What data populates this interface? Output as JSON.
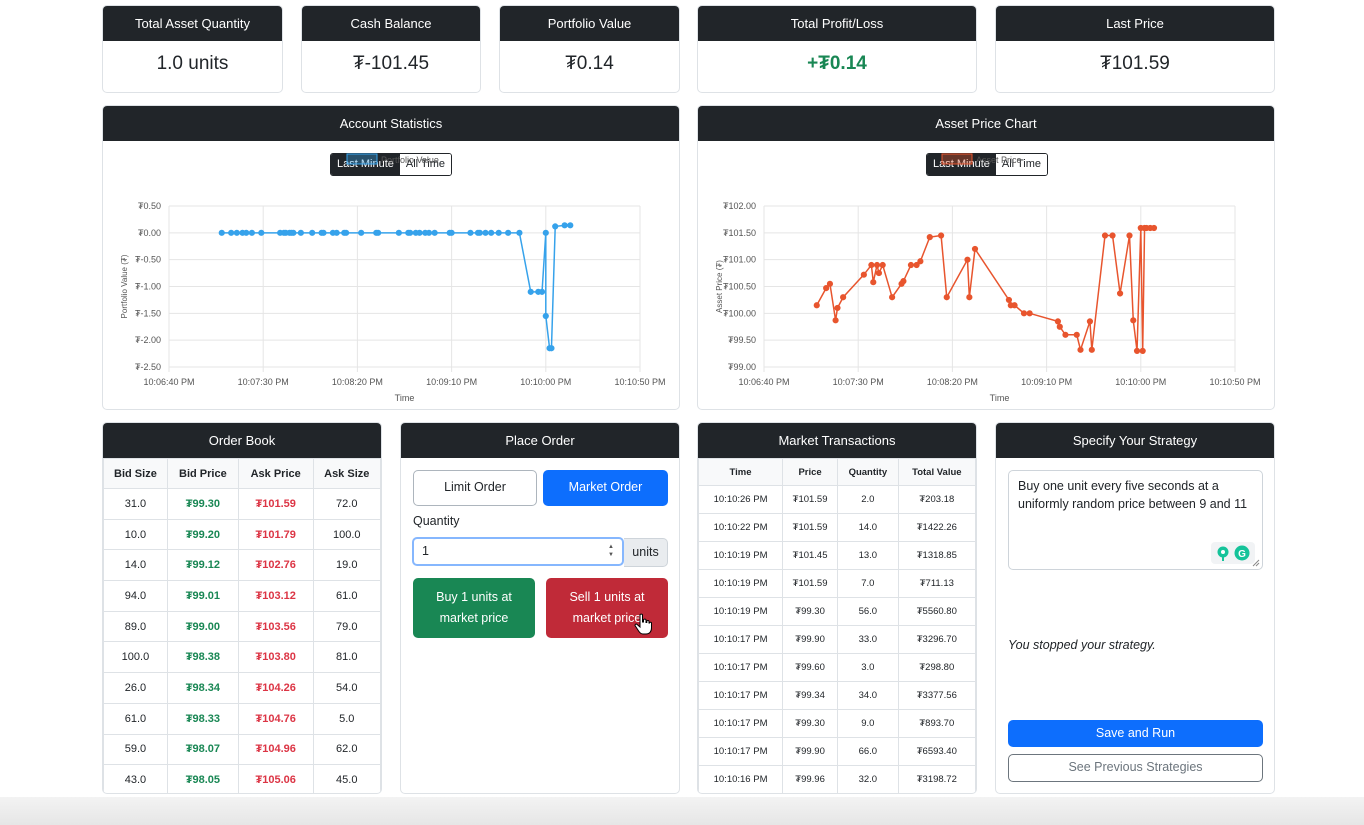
{
  "stats": [
    {
      "title": "Total Asset Quantity",
      "value": "1.0 units"
    },
    {
      "title": "Cash Balance",
      "value": "₮-101.45"
    },
    {
      "title": "Portfolio Value",
      "value": "₮0.14"
    },
    {
      "title": "Total Profit/Loss",
      "value": "+₮0.14"
    },
    {
      "title": "Last Price",
      "value": "₮101.59"
    }
  ],
  "account_chart": {
    "header": "Account Statistics",
    "toggle_on": "Last Minute",
    "toggle_off": "All Time",
    "legend": "Portfolio Value",
    "ylabel": "Portfolio Value (₮)",
    "xlabel": "Time",
    "yticks": [
      "₮0.50",
      "₮0.00",
      "₮-0.50",
      "₮-1.00",
      "₮-1.50",
      "₮-2.00",
      "₮-2.50"
    ],
    "xticks": [
      "10:06:40 PM",
      "10:07:30 PM",
      "10:08:20 PM",
      "10:09:10 PM",
      "10:10:00 PM",
      "10:10:50 PM"
    ],
    "color": "#36a2eb"
  },
  "price_chart": {
    "header": "Asset Price Chart",
    "toggle_on": "Last Minute",
    "toggle_off": "All Time",
    "legend": "Asset Price",
    "ylabel": "Asset Price (₮)",
    "xlabel": "Time",
    "yticks": [
      "₮102.00",
      "₮101.50",
      "₮101.00",
      "₮100.50",
      "₮100.00",
      "₮99.50",
      "₮99.00"
    ],
    "xticks": [
      "10:06:40 PM",
      "10:07:30 PM",
      "10:08:20 PM",
      "10:09:10 PM",
      "10:10:00 PM",
      "10:10:50 PM"
    ],
    "color": "#e8552e"
  },
  "chart_data": [
    {
      "type": "line",
      "title": "Account Statistics",
      "xlabel": "Time",
      "ylabel": "Portfolio Value (₮)",
      "ylim": [
        -2.5,
        0.5
      ],
      "xlim_seconds_after_10:06:40": [
        0,
        250
      ],
      "series": [
        {
          "name": "Portfolio Value",
          "x_seconds": [
            28,
            33,
            36,
            39,
            41,
            44,
            49,
            59,
            61,
            62,
            64,
            65,
            66,
            70,
            76,
            81,
            82,
            87,
            89,
            93,
            94,
            102,
            110,
            111,
            122,
            127,
            128,
            131,
            133,
            136,
            138,
            141,
            149,
            150,
            160,
            164,
            165,
            168,
            171,
            175,
            180,
            186,
            192,
            196,
            198,
            200,
            200,
            202,
            203,
            205,
            210,
            213
          ],
          "y": [
            0,
            0,
            0,
            0,
            0,
            0,
            0,
            0,
            0,
            0,
            0,
            0,
            0,
            0,
            0,
            0,
            0,
            0,
            0,
            0,
            0,
            0,
            0,
            0,
            0,
            0,
            0,
            0,
            0,
            0,
            0,
            0,
            0,
            0,
            0,
            0,
            0,
            0,
            0,
            0,
            0,
            0,
            -1.1,
            -1.1,
            -1.1,
            0,
            -1.55,
            -2.15,
            -2.15,
            0.12,
            0.14,
            0.14
          ]
        }
      ]
    },
    {
      "type": "line",
      "title": "Asset Price Chart",
      "xlabel": "Time",
      "ylabel": "Asset Price (₮)",
      "ylim": [
        99.0,
        102.0
      ],
      "xlim_seconds_after_10:06:40": [
        0,
        250
      ],
      "series": [
        {
          "name": "Asset Price",
          "x_seconds": [
            28,
            33,
            35,
            38,
            39,
            42,
            53,
            57,
            58,
            60,
            61,
            63,
            68,
            73,
            74,
            78,
            81,
            83,
            88,
            94,
            97,
            108,
            109,
            112,
            130,
            131,
            133,
            138,
            141,
            156,
            157,
            160,
            166,
            168,
            173,
            174,
            181,
            185,
            189,
            194,
            196,
            198,
            200,
            201,
            202,
            203,
            205,
            207
          ],
          "y": [
            100.15,
            100.47,
            100.55,
            99.87,
            100.1,
            100.3,
            100.72,
            100.9,
            100.58,
            100.9,
            100.75,
            100.9,
            100.3,
            100.55,
            100.6,
            100.9,
            100.9,
            100.97,
            101.42,
            101.45,
            100.3,
            101.0,
            100.3,
            101.2,
            100.25,
            100.15,
            100.15,
            100.0,
            100.0,
            99.85,
            99.75,
            99.6,
            99.6,
            99.32,
            99.85,
            99.32,
            101.45,
            101.45,
            100.37,
            101.45,
            99.87,
            99.3,
            101.59,
            99.3,
            101.59,
            101.59,
            101.59,
            101.59
          ]
        }
      ]
    }
  ],
  "order_book": {
    "header": "Order Book",
    "columns": [
      "Bid Size",
      "Bid Price",
      "Ask Price",
      "Ask Size"
    ],
    "rows": [
      [
        "31.0",
        "₮99.30",
        "₮101.59",
        "72.0"
      ],
      [
        "10.0",
        "₮99.20",
        "₮101.79",
        "100.0"
      ],
      [
        "14.0",
        "₮99.12",
        "₮102.76",
        "19.0"
      ],
      [
        "94.0",
        "₮99.01",
        "₮103.12",
        "61.0"
      ],
      [
        "89.0",
        "₮99.00",
        "₮103.56",
        "79.0"
      ],
      [
        "100.0",
        "₮98.38",
        "₮103.80",
        "81.0"
      ],
      [
        "26.0",
        "₮98.34",
        "₮104.26",
        "54.0"
      ],
      [
        "61.0",
        "₮98.33",
        "₮104.76",
        "5.0"
      ],
      [
        "59.0",
        "₮98.07",
        "₮104.96",
        "62.0"
      ],
      [
        "43.0",
        "₮98.05",
        "₮105.06",
        "45.0"
      ]
    ]
  },
  "place_order": {
    "header": "Place Order",
    "limit_label": "Limit Order",
    "market_label": "Market Order",
    "quantity_label": "Quantity",
    "quantity_value": "1",
    "units_label": "units",
    "buy_line1": "Buy 1 units at",
    "buy_line2": "market price",
    "sell_line1": "Sell 1 units at",
    "sell_line2": "market price"
  },
  "transactions": {
    "header": "Market Transactions",
    "columns": [
      "Time",
      "Price",
      "Quantity",
      "Total Value"
    ],
    "rows": [
      [
        "10:10:26 PM",
        "₮101.59",
        "2.0",
        "₮203.18"
      ],
      [
        "10:10:22 PM",
        "₮101.59",
        "14.0",
        "₮1422.26"
      ],
      [
        "10:10:19 PM",
        "₮101.45",
        "13.0",
        "₮1318.85"
      ],
      [
        "10:10:19 PM",
        "₮101.59",
        "7.0",
        "₮711.13"
      ],
      [
        "10:10:19 PM",
        "₮99.30",
        "56.0",
        "₮5560.80"
      ],
      [
        "10:10:17 PM",
        "₮99.90",
        "33.0",
        "₮3296.70"
      ],
      [
        "10:10:17 PM",
        "₮99.60",
        "3.0",
        "₮298.80"
      ],
      [
        "10:10:17 PM",
        "₮99.34",
        "34.0",
        "₮3377.56"
      ],
      [
        "10:10:17 PM",
        "₮99.30",
        "9.0",
        "₮893.70"
      ],
      [
        "10:10:17 PM",
        "₮99.90",
        "66.0",
        "₮6593.40"
      ],
      [
        "10:10:16 PM",
        "₮99.96",
        "32.0",
        "₮3198.72"
      ]
    ]
  },
  "strategy": {
    "header": "Specify Your Strategy",
    "text": "Buy one unit every five seconds at a uniformly random price between 9 and 11",
    "status": "You stopped your strategy.",
    "save_label": "Save and Run",
    "prev_label": "See Previous Strategies"
  }
}
